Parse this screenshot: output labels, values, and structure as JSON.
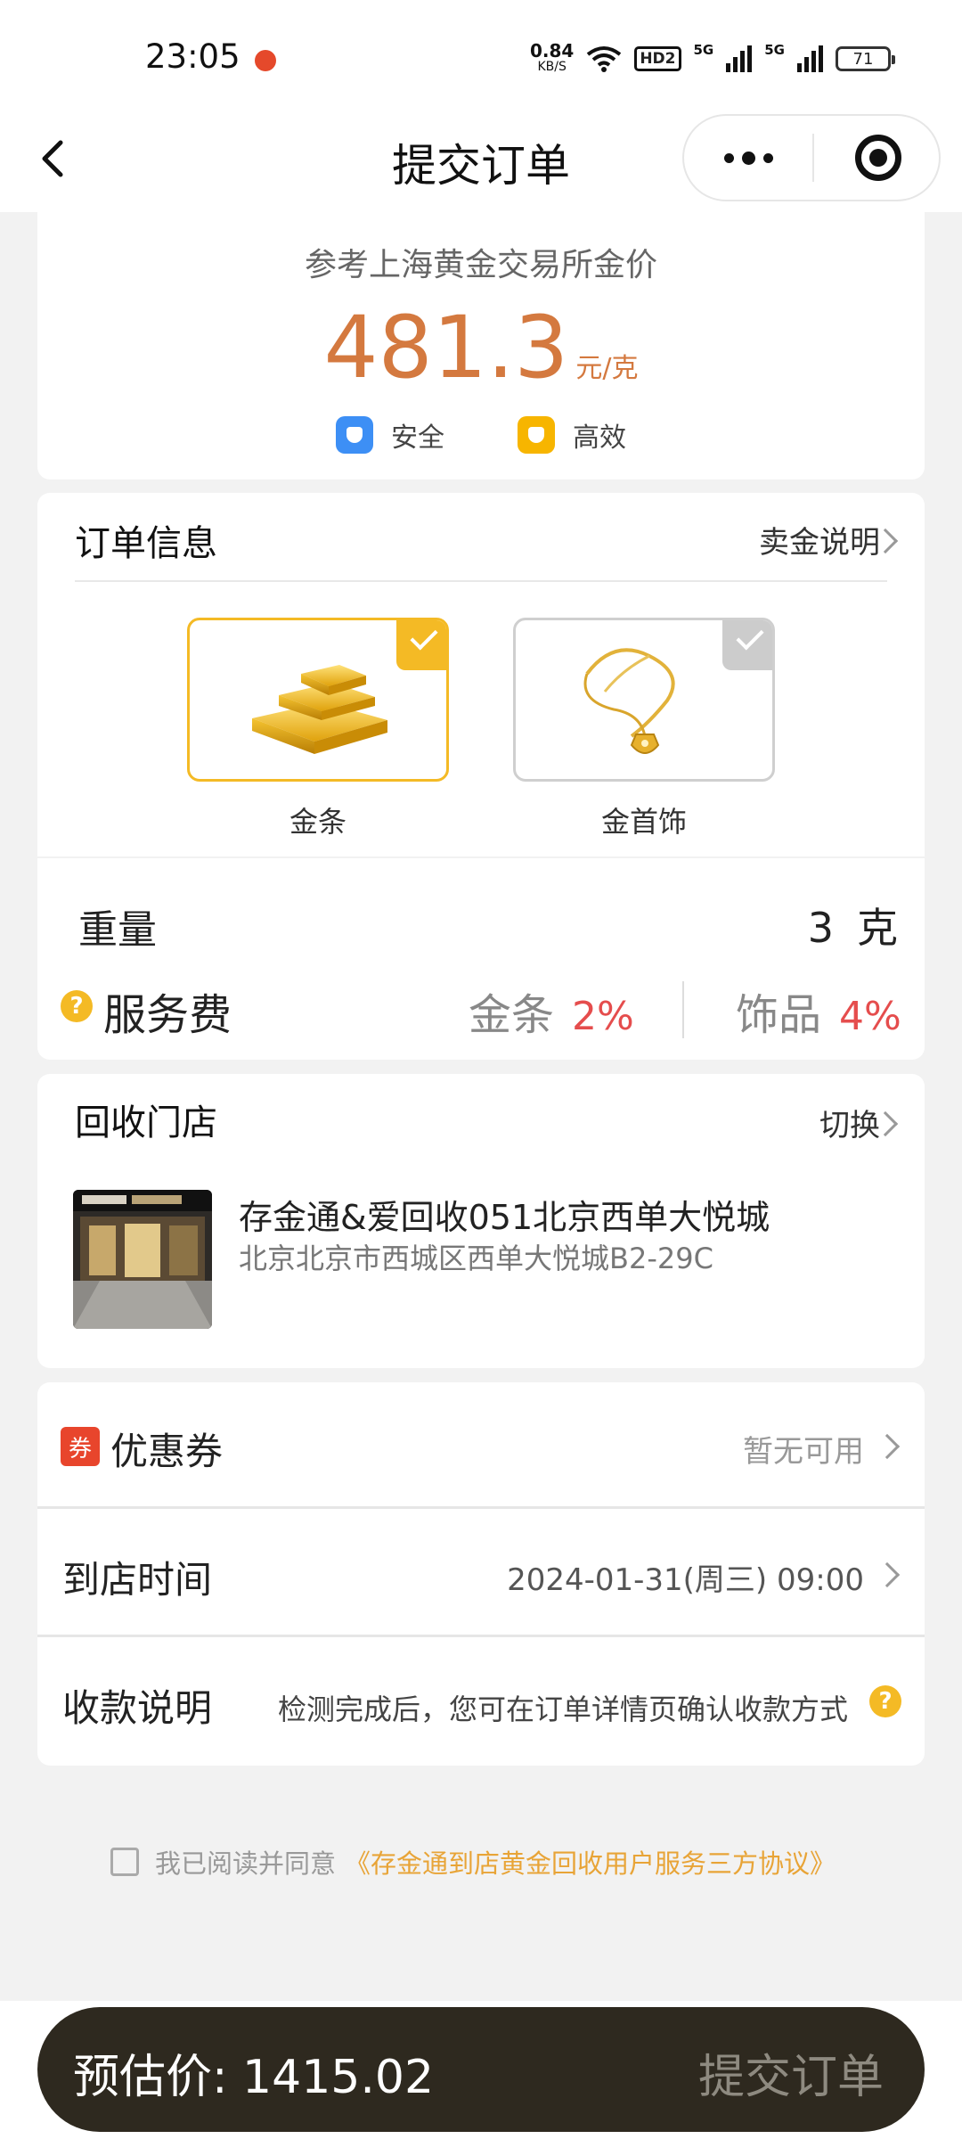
{
  "status_bar": {
    "time": "23:05",
    "net_speed": "0.84",
    "net_unit": "KB/S",
    "hd_label": "HD2",
    "sig1": "5G",
    "sig2": "5G",
    "battery": "71"
  },
  "nav": {
    "title": "提交订单"
  },
  "price_card": {
    "reference": "参考上海黄金交易所金价",
    "price": "481.3",
    "unit": "元/克",
    "tag_safe": "安全",
    "tag_fast": "高效"
  },
  "order_info": {
    "title": "订单信息",
    "link": "卖金说明",
    "options": [
      {
        "label": "金条",
        "selected": true
      },
      {
        "label": "金首饰",
        "selected": false
      }
    ]
  },
  "weight": {
    "label": "重量",
    "value": "3",
    "unit": "克"
  },
  "service_fee": {
    "label": "服务费",
    "bar_label": "金条",
    "bar_pct": "2%",
    "jewelry_label": "饰品",
    "jewelry_pct": "4%"
  },
  "store": {
    "title": "回收门店",
    "switch": "切换",
    "name": "存金通&爱回收051北京西单大悦城",
    "address": "北京北京市西城区西单大悦城B2-29C"
  },
  "coupon": {
    "icon_text": "券",
    "label": "优惠券",
    "value": "暂无可用"
  },
  "arrival": {
    "label": "到店时间",
    "value": "2024-01-31(周三) 09:00"
  },
  "payment": {
    "label": "收款说明",
    "note": "检测完成后，您可在订单详情页确认收款方式"
  },
  "agreement": {
    "text": "我已阅读并同意",
    "link": "《存金通到店黄金回收用户服务三方协议》"
  },
  "bottom": {
    "estimate": "预估价: 1415.02",
    "submit": "提交订单"
  },
  "colors": {
    "accent_gold": "#f4ba25",
    "price_orange": "#d4793f",
    "fee_red": "#e54d4d",
    "submit_bar": "#2e291f"
  }
}
